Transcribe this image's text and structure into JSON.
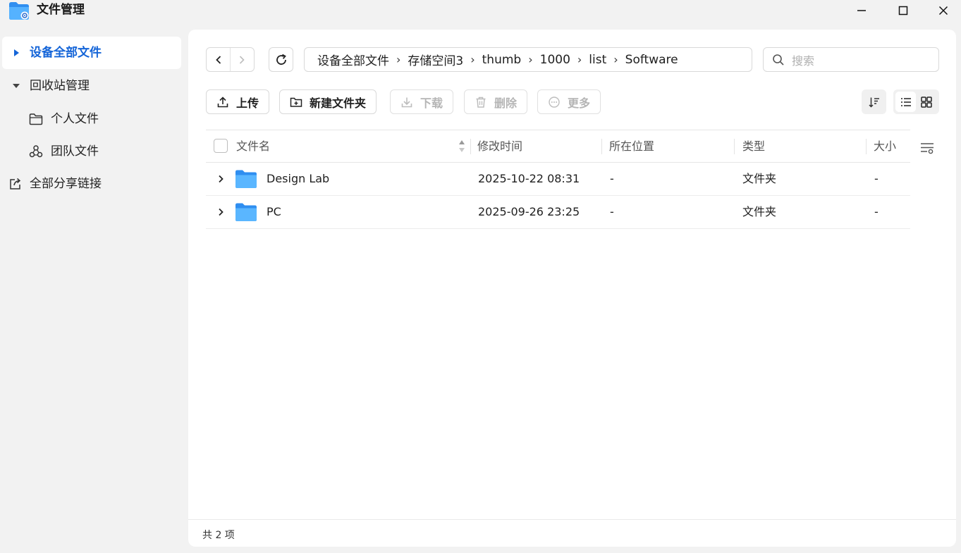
{
  "app": {
    "title": "文件管理"
  },
  "sidebar": {
    "items": [
      {
        "label": "设备全部文件"
      },
      {
        "label": "回收站管理"
      },
      {
        "label": "个人文件"
      },
      {
        "label": "团队文件"
      },
      {
        "label": "全部分享链接"
      }
    ]
  },
  "breadcrumb": [
    "设备全部文件",
    "存储空间3",
    "thumb",
    "1000",
    "list",
    "Software"
  ],
  "search": {
    "placeholder": "搜索"
  },
  "toolbar": {
    "upload": "上传",
    "new_folder": "新建文件夹",
    "download": "下载",
    "delete": "删除",
    "more": "更多"
  },
  "table": {
    "columns": {
      "name": "文件名",
      "modified": "修改时间",
      "location": "所在位置",
      "type": "类型",
      "size": "大小"
    },
    "rows": [
      {
        "name": "Design Lab",
        "modified": "2025-10-22 08:31",
        "location": "-",
        "type": "文件夹",
        "size": "-"
      },
      {
        "name": "PC",
        "modified": "2025-09-26 23:25",
        "location": "-",
        "type": "文件夹",
        "size": "-"
      }
    ]
  },
  "footer": {
    "summary": "共 2 项"
  },
  "colors": {
    "accent": "#1565d8",
    "folder": "#3aa0f3"
  }
}
